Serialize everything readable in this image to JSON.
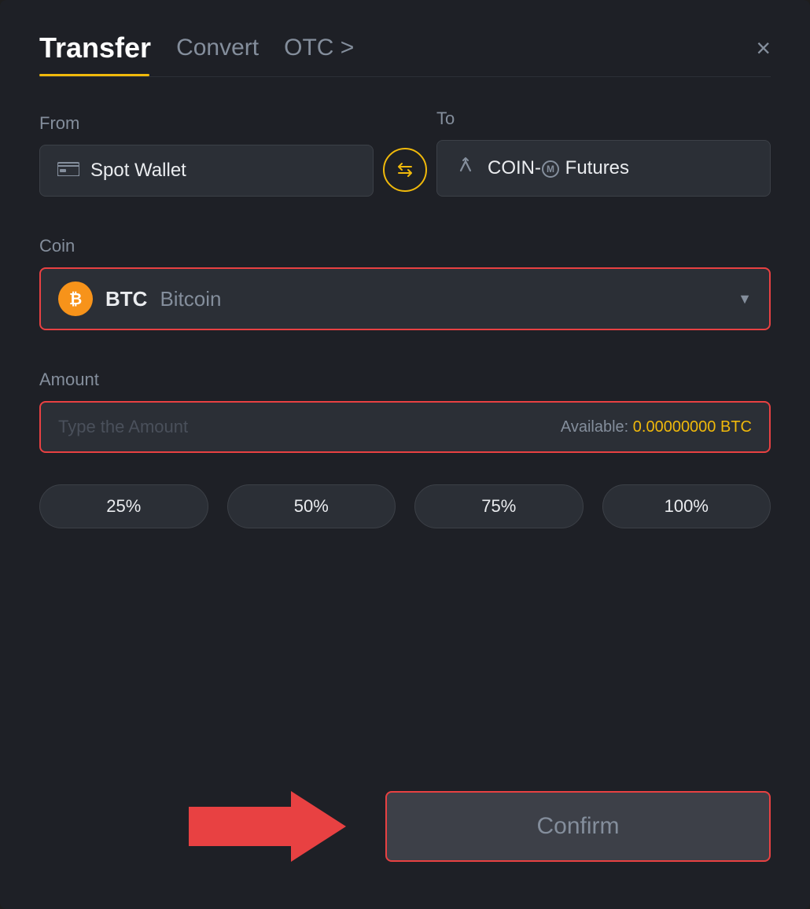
{
  "header": {
    "active_tab": "Transfer",
    "tabs": [
      {
        "id": "transfer",
        "label": "Transfer"
      },
      {
        "id": "convert",
        "label": "Convert"
      },
      {
        "id": "otc",
        "label": "OTC >"
      }
    ],
    "close_label": "×"
  },
  "from_section": {
    "label": "From",
    "wallet_icon": "💳",
    "wallet_name": "Spot Wallet"
  },
  "to_section": {
    "label": "To",
    "futures_icon": "↑",
    "futures_name": "COIN-M Futures"
  },
  "swap_button": {
    "icon": "⇄"
  },
  "coin_section": {
    "label": "Coin",
    "symbol": "BTC",
    "name": "Bitcoin"
  },
  "amount_section": {
    "label": "Amount",
    "placeholder": "Type the Amount",
    "available_label": "Available:",
    "available_amount": "0.00000000",
    "available_currency": "BTC"
  },
  "percentage_buttons": [
    {
      "label": "25%"
    },
    {
      "label": "50%"
    },
    {
      "label": "75%"
    },
    {
      "label": "100%"
    }
  ],
  "confirm_button": {
    "label": "Confirm"
  }
}
